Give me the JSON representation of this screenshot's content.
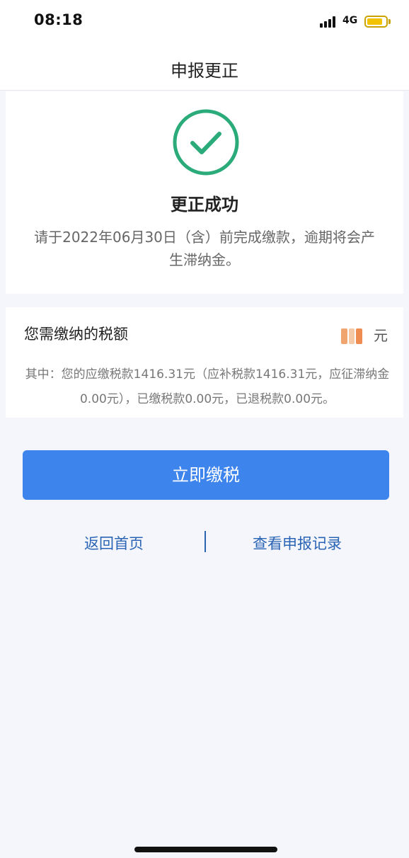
{
  "status_bar": {
    "time": "08:18",
    "network": "4G",
    "icons": [
      "signal-icon",
      "battery-icon"
    ]
  },
  "nav": {
    "title": "申报更正"
  },
  "success": {
    "icon": "check-circle-icon",
    "title": "更正成功",
    "message": "请于2022年06月30日（含）前完成缴款，逾期将会产生滞纳金。"
  },
  "tax": {
    "label": "您需缴纳的税额",
    "unit": "元",
    "detail": "其中：您的应缴税款1416.31元（应补税款1416.31元，应征滞纳金0.00元），已缴税款0.00元，已退税款0.00元。"
  },
  "actions": {
    "pay_label": "立即缴税",
    "home_label": "返回首页",
    "records_label": "查看申报记录"
  },
  "colors": {
    "accent": "#3d84ec",
    "success": "#2bab7a",
    "link": "#2a64b4"
  }
}
